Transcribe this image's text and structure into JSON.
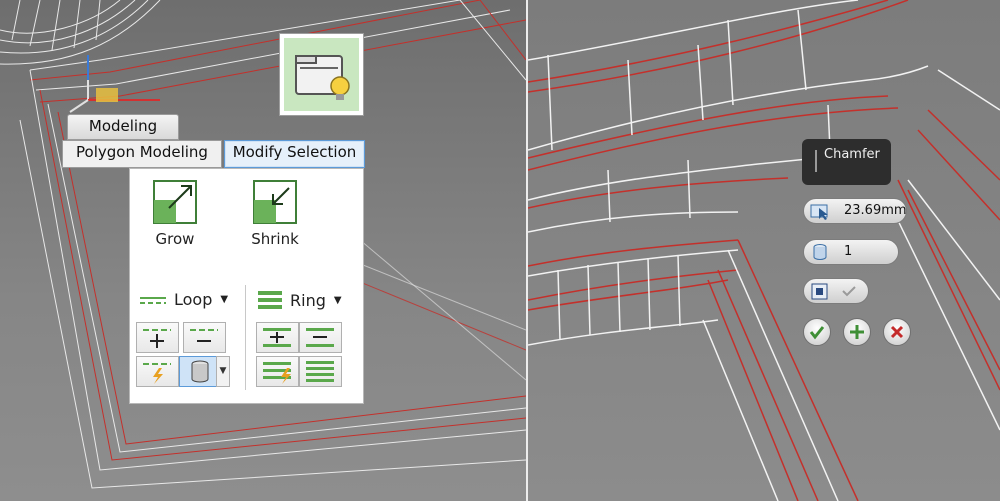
{
  "ribbon": {
    "tab_modeling": "Modeling",
    "tab_polygon_modeling": "Polygon Modeling",
    "tab_modify_selection": "Modify Selection",
    "grow_label": "Grow",
    "shrink_label": "Shrink",
    "loop_label": "Loop",
    "ring_label": "Ring"
  },
  "caddy": {
    "title": "Chamfer",
    "amount": "23.69mm",
    "segments": "1"
  },
  "icons": {
    "folder_tile": "open-folder-bulb-icon",
    "grow": "grow-selection-icon",
    "shrink": "shrink-selection-icon"
  },
  "colors": {
    "wire_red": "#c4302b",
    "wire_white": "#ffffff",
    "accent_green": "#5aa84b",
    "selection_blue": "#5c9ad8"
  }
}
